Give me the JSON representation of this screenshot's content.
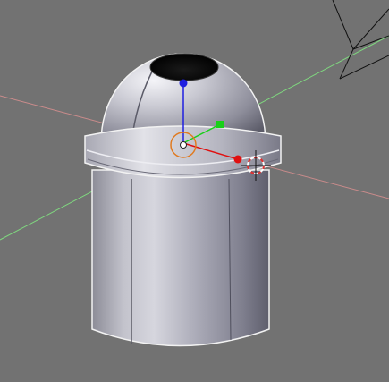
{
  "viewport": {
    "background": "#727272",
    "axis_x_color": "#c98b8b",
    "axis_y_color": "#7fd67f",
    "gizmo_x_color": "#e01010",
    "gizmo_y_color": "#18d018",
    "gizmo_z_color": "#1f1fe0",
    "origin_color": "#e07a20",
    "selection_outline_color": "#f2f2f2",
    "camera_wire_color": "#111111"
  },
  "object": {
    "type": "mesh",
    "shape": "domed-cylinder",
    "material_shade": "#b9b9c4"
  },
  "tools": {
    "transform_gizmo": "translate-manipulator-icon",
    "cursor_3d": "3d-cursor-icon",
    "camera": "camera-wireframe-icon"
  }
}
